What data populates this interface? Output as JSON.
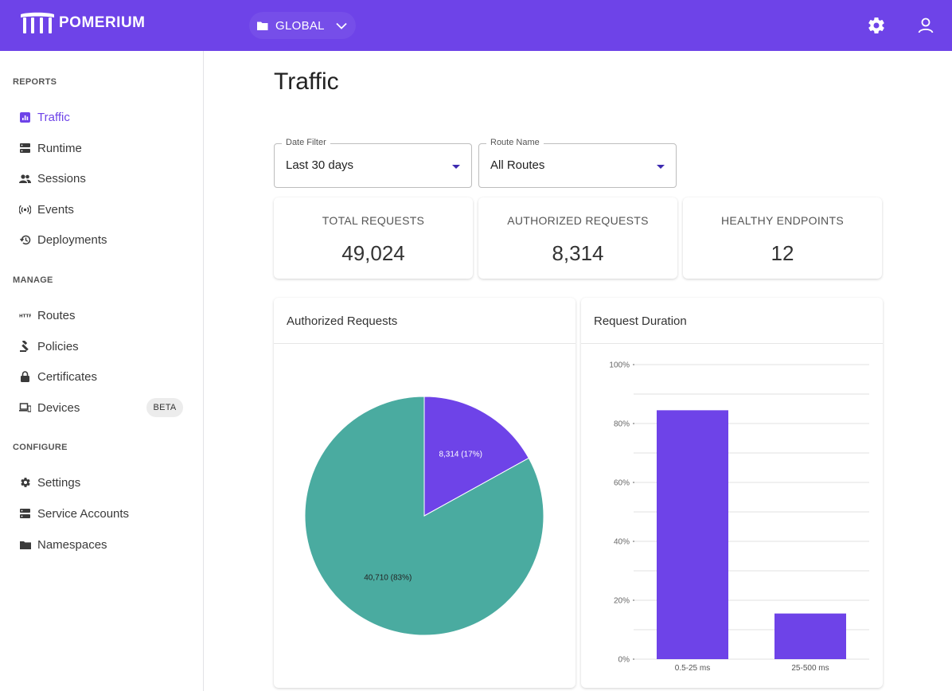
{
  "header": {
    "brand": "POMERIUM",
    "namespace": "GLOBAL",
    "icons": {
      "namespace": "folder-icon",
      "chevron": "chevron-down-icon",
      "settings": "gear-icon",
      "user": "user-icon"
    },
    "color": "#6e43e8"
  },
  "sidebar": {
    "reports": {
      "title": "REPORTS",
      "items": [
        {
          "label": "Traffic",
          "icon": "bar-chart-icon",
          "active": true
        },
        {
          "label": "Runtime",
          "icon": "server-icon"
        },
        {
          "label": "Sessions",
          "icon": "people-icon"
        },
        {
          "label": "Events",
          "icon": "broadcast-icon"
        },
        {
          "label": "Deployments",
          "icon": "history-icon"
        }
      ]
    },
    "manage": {
      "title": "MANAGE",
      "items": [
        {
          "label": "Routes",
          "icon": "http-icon"
        },
        {
          "label": "Policies",
          "icon": "gavel-icon"
        },
        {
          "label": "Certificates",
          "icon": "lock-icon"
        },
        {
          "label": "Devices",
          "icon": "devices-icon",
          "badge": "BETA"
        }
      ]
    },
    "configure": {
      "title": "CONFIGURE",
      "items": [
        {
          "label": "Settings",
          "icon": "gear-icon"
        },
        {
          "label": "Service Accounts",
          "icon": "server-icon"
        },
        {
          "label": "Namespaces",
          "icon": "folder-icon"
        }
      ]
    }
  },
  "main": {
    "title": "Traffic",
    "filters": {
      "date": {
        "label": "Date Filter",
        "value": "Last 30 days"
      },
      "route": {
        "label": "Route Name",
        "value": "All Routes"
      }
    },
    "stats": [
      {
        "label": "TOTAL REQUESTS",
        "value": "49,024"
      },
      {
        "label": "AUTHORIZED REQUESTS",
        "value": "8,314"
      },
      {
        "label": "HEALTHY ENDPOINTS",
        "value": "12"
      }
    ],
    "cards": {
      "authorized": "Authorized Requests",
      "duration": "Request Duration"
    }
  },
  "chart_data": [
    {
      "type": "pie",
      "title": "Authorized Requests",
      "slices": [
        {
          "value": 8314,
          "label": "8,314 (17%)",
          "color": "#6e43e8"
        },
        {
          "value": 40710,
          "label": "40,710 (83%)",
          "color": "#4aaba0"
        }
      ]
    },
    {
      "type": "bar",
      "title": "Request Duration",
      "categories": [
        "0.5-25 ms",
        "25-500 ms"
      ],
      "values": [
        84.5,
        15.5
      ],
      "ylim": [
        0,
        100
      ],
      "yticks": [
        "0%",
        "20%",
        "40%",
        "60%",
        "80%",
        "100%"
      ],
      "ytick_values": [
        0,
        20,
        40,
        60,
        80,
        100
      ],
      "grid": true,
      "color": "#6e43e8"
    }
  ]
}
